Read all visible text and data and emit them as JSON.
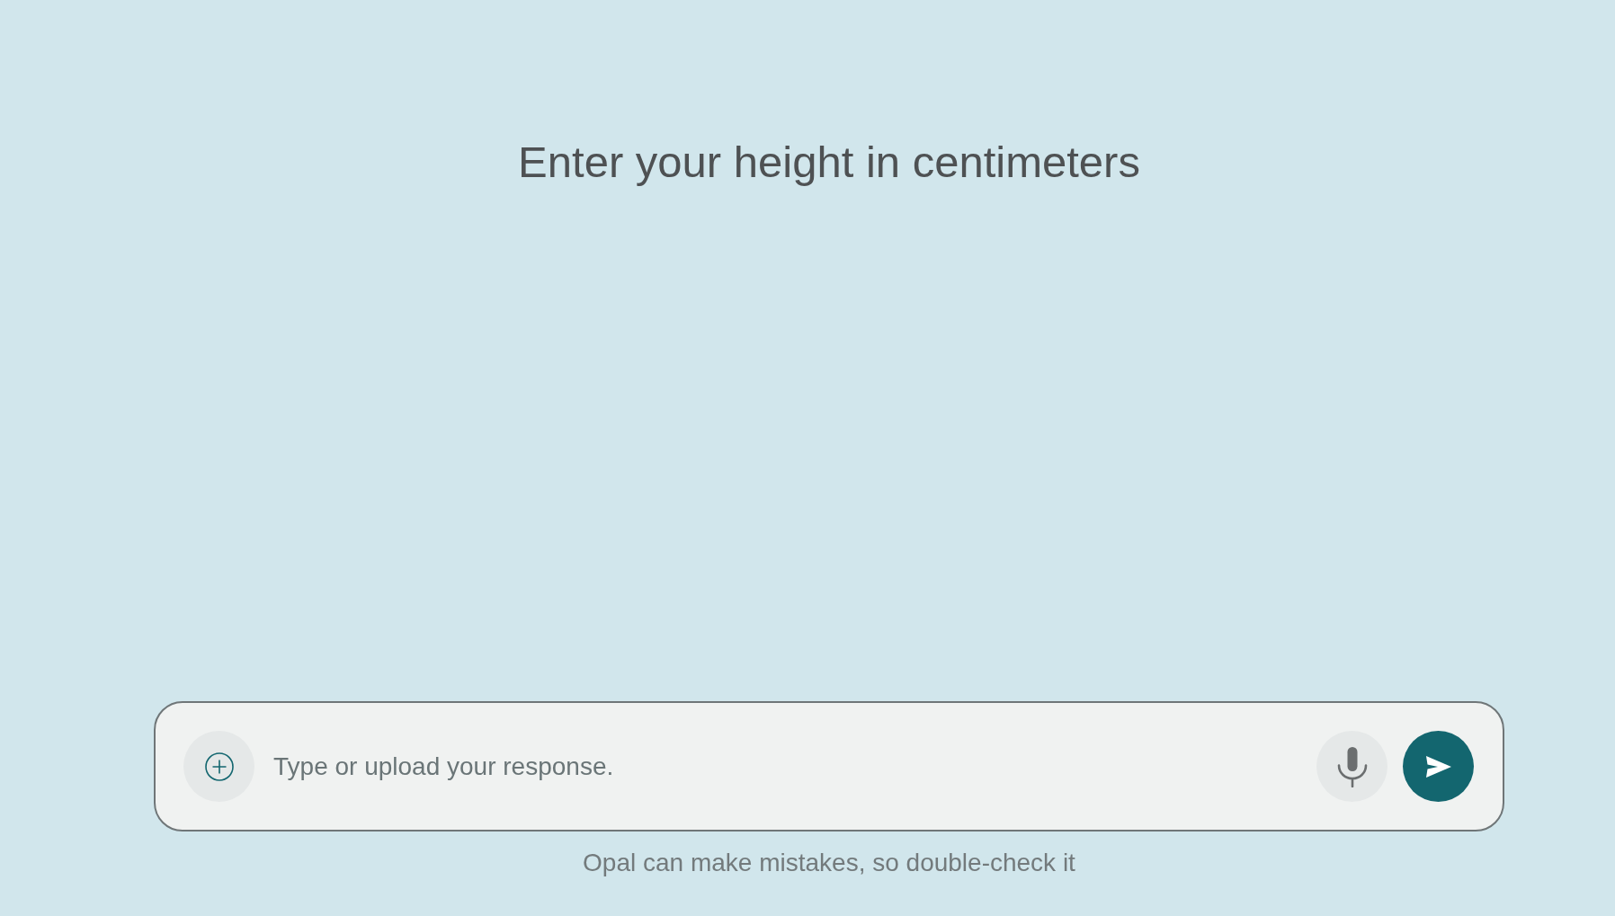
{
  "prompt": {
    "title": "Enter your height in centimeters"
  },
  "response_bar": {
    "placeholder": "Type or upload your response."
  },
  "disclaimer": "Opal can make mistakes, so double-check it"
}
